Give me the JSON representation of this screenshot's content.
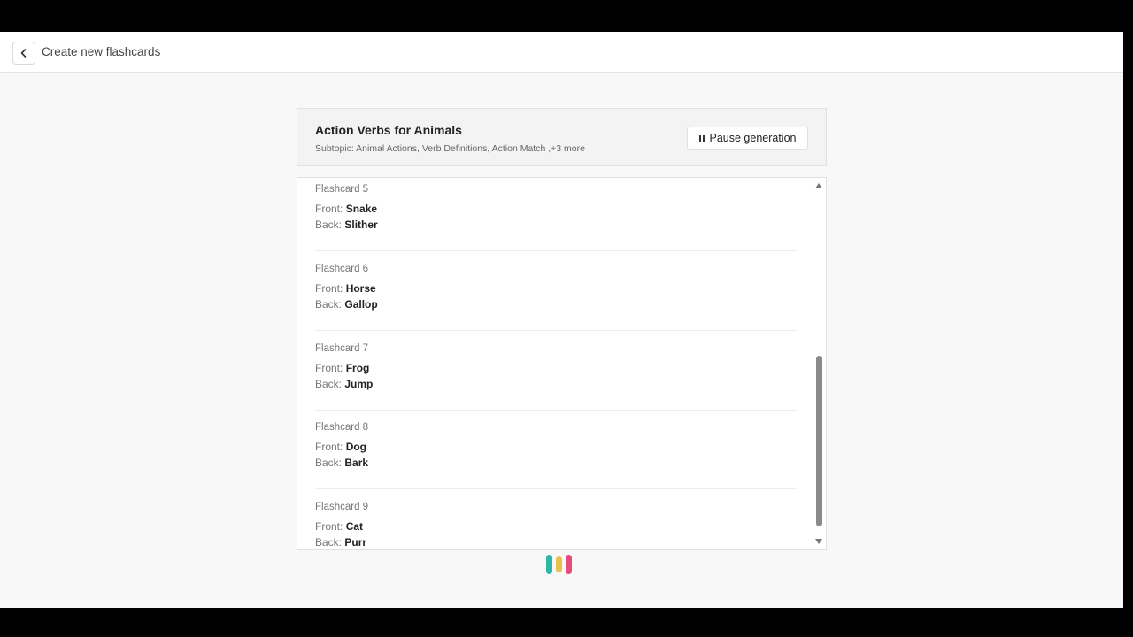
{
  "topbar": {
    "title": "Create new flashcards"
  },
  "header": {
    "title": "Action Verbs for Animals",
    "subtitle": "Subtopic: Animal Actions, Verb Definitions, Action Match ,+3 more",
    "pause_label": "Pause generation"
  },
  "labels": {
    "front": "Front: ",
    "back": "Back: "
  },
  "cards": [
    {
      "title": "Flashcard 5",
      "front": "Snake",
      "back": "Slither"
    },
    {
      "title": "Flashcard 6",
      "front": "Horse",
      "back": "Gallop"
    },
    {
      "title": "Flashcard 7",
      "front": "Frog",
      "back": "Jump"
    },
    {
      "title": "Flashcard 8",
      "front": "Dog",
      "back": "Bark"
    },
    {
      "title": "Flashcard 9",
      "front": "Cat",
      "back": "Purr"
    }
  ],
  "icons": {
    "back": "chevron-left-icon",
    "pause": "pause-icon",
    "loader": "loading-bars-icon"
  },
  "colors": {
    "loader": [
      "#2fb7a5",
      "#e8c14d",
      "#e74b7a"
    ]
  }
}
